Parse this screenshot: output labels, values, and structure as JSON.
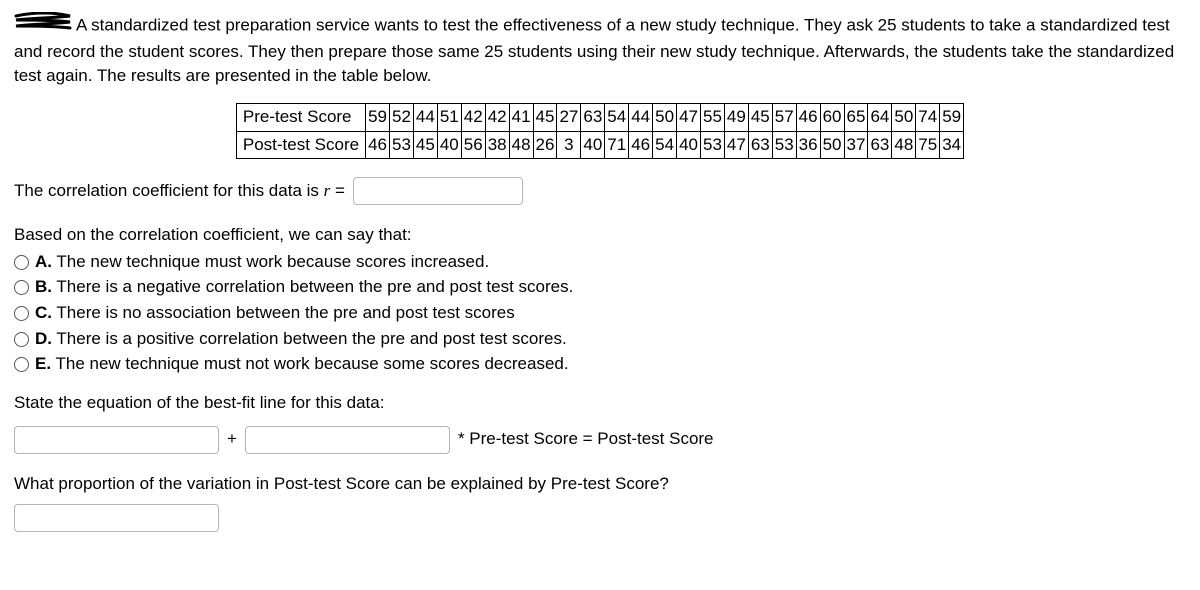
{
  "intro": "A standardized test preparation service wants to test the effectiveness of a new study technique. They ask 25 students to take a standardized test and record the student scores. They then prepare those same 25 students using their new study technique. Afterwards, the students take the standardized test again. The results are presented in the table below.",
  "table": {
    "row1_label": "Pre-test Score",
    "row2_label": "Post-test Score",
    "pre": [
      59,
      52,
      44,
      51,
      42,
      42,
      41,
      45,
      27,
      63,
      54,
      44,
      50,
      47,
      55,
      49,
      45,
      57,
      46,
      60,
      65,
      64,
      50,
      74,
      59
    ],
    "post": [
      46,
      53,
      45,
      40,
      56,
      38,
      48,
      26,
      3,
      40,
      71,
      46,
      54,
      40,
      53,
      47,
      63,
      53,
      36,
      50,
      37,
      63,
      48,
      75,
      34
    ]
  },
  "corr": {
    "prefix": "The correlation coefficient for this data is ",
    "r_symbol": "r",
    "equals": " ="
  },
  "mc": {
    "prompt": "Based on the correlation coefficient, we can say that:",
    "options": [
      {
        "letter": "A.",
        "text": " The new technique must work because scores increased."
      },
      {
        "letter": "B.",
        "text": " There is a negative correlation between the pre and post test scores."
      },
      {
        "letter": "C.",
        "text": " There is no association between the pre and post test scores"
      },
      {
        "letter": "D.",
        "text": " There is a positive correlation between the pre and post test scores."
      },
      {
        "letter": "E.",
        "text": " The new technique must not work because some scores decreased."
      }
    ]
  },
  "bestfit": {
    "prompt": "State the equation of the best-fit line for this data:",
    "plus": "+",
    "suffix": "* Pre-test Score = Post-test Score"
  },
  "proportion": {
    "prompt": "What proportion of the variation in Post-test Score can be explained by Pre-test Score?"
  }
}
